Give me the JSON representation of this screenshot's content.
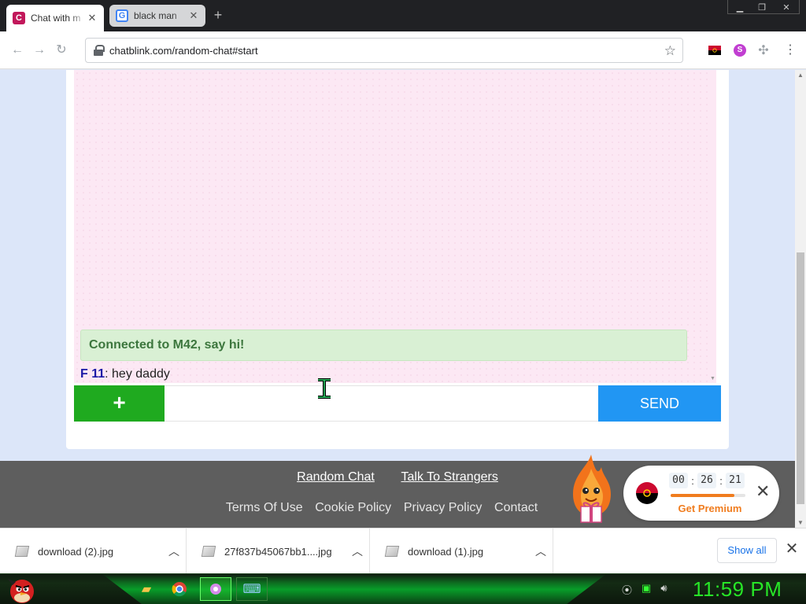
{
  "browser": {
    "tabs": [
      {
        "title": "Chat with m",
        "favicon": "C",
        "active": true
      },
      {
        "title": "black man",
        "favicon": "G",
        "active": false
      }
    ],
    "url": "chatblink.com/random-chat#start"
  },
  "chat": {
    "system_message": "Connected to M42, say hi!",
    "messages": [
      {
        "sender": "F 11",
        "text": ": hey daddy"
      }
    ],
    "input": {
      "value": "",
      "placeholder": ""
    },
    "plus_label": "+",
    "send_label": "SEND"
  },
  "footer": {
    "primary_links": [
      "Random Chat",
      "Talk To Strangers"
    ],
    "secondary_links": [
      "Terms Of Use",
      "Cookie Policy",
      "Privacy Policy",
      "Contact"
    ]
  },
  "promo": {
    "timer": [
      "00",
      "26",
      "21"
    ],
    "timer_sep": ":",
    "progress": 0.85,
    "cta": "Get Premium",
    "close": "✕"
  },
  "downloads": {
    "items": [
      "download (2).jpg",
      "27f837b45067bb1....jpg",
      "download (1).jpg"
    ],
    "show_all": "Show all"
  },
  "taskbar": {
    "clock": "11:59 PM"
  },
  "colors": {
    "accent_green": "#1faa1f",
    "send_blue": "#2196f3",
    "premium_orange": "#f07c1e",
    "clock_green": "#27e627"
  }
}
